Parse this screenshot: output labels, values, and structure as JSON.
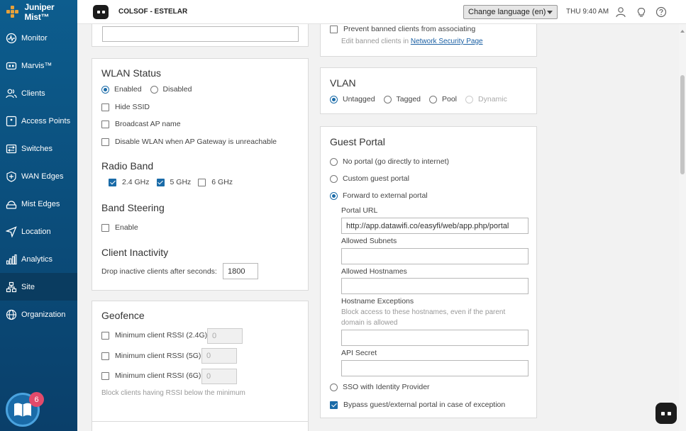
{
  "brand": {
    "name": "Juniper Mist™"
  },
  "sidebar": {
    "items": [
      {
        "label": "Monitor",
        "icon": "monitor-icon"
      },
      {
        "label": "Marvis™",
        "icon": "marvis-icon"
      },
      {
        "label": "Clients",
        "icon": "clients-icon"
      },
      {
        "label": "Access Points",
        "icon": "access-point-icon"
      },
      {
        "label": "Switches",
        "icon": "switch-icon"
      },
      {
        "label": "WAN Edges",
        "icon": "wan-edge-icon"
      },
      {
        "label": "Mist Edges",
        "icon": "mist-edge-icon"
      },
      {
        "label": "Location",
        "icon": "location-icon"
      },
      {
        "label": "Analytics",
        "icon": "analytics-icon"
      },
      {
        "label": "Site",
        "icon": "site-icon"
      },
      {
        "label": "Organization",
        "icon": "organization-icon"
      }
    ],
    "active": "Site",
    "help_badge": "6"
  },
  "topbar": {
    "org_name": "COLSOF - ESTELAR",
    "language_button": "Change language (en)",
    "clock": "THU 9:40 AM"
  },
  "banned": {
    "prevent_label": "Prevent banned clients from associating",
    "edit_prefix": "Edit banned clients in",
    "edit_link": "Network Security Page"
  },
  "wlan_status": {
    "title": "WLAN Status",
    "enabled": "Enabled",
    "disabled": "Disabled",
    "hide_ssid": "Hide SSID",
    "broadcast_ap": "Broadcast AP name",
    "disable_wlan": "Disable WLAN when AP Gateway is unreachable"
  },
  "radio_band": {
    "title": "Radio Band",
    "b24": "2.4 GHz",
    "b5": "5 GHz",
    "b6": "6 GHz"
  },
  "band_steering": {
    "title": "Band Steering",
    "enable": "Enable"
  },
  "client_inactivity": {
    "title": "Client Inactivity",
    "label": "Drop inactive clients after seconds:",
    "value": "1800"
  },
  "geofence": {
    "title": "Geofence",
    "rssi24": "Minimum client RSSI (2.4G)",
    "rssi5": "Minimum client RSSI (5G)",
    "rssi6": "Minimum client RSSI (6G)",
    "rssi_value": "0",
    "note": "Block clients having RSSI below the minimum"
  },
  "vlan": {
    "title": "VLAN",
    "untagged": "Untagged",
    "tagged": "Tagged",
    "pool": "Pool",
    "dynamic": "Dynamic"
  },
  "guest_portal": {
    "title": "Guest Portal",
    "no_portal": "No portal (go directly to internet)",
    "custom": "Custom guest portal",
    "external": "Forward to external portal",
    "portal_url_label": "Portal URL",
    "portal_url_value": "http://app.datawifi.co/easyfi/web/app.php/portal",
    "allowed_subnets": "Allowed Subnets",
    "allowed_hostnames": "Allowed Hostnames",
    "hostname_exceptions": "Hostname Exceptions",
    "hostname_exceptions_help_1": "Block access to these hostnames, even if the parent",
    "hostname_exceptions_help_2": "domain is allowed",
    "api_secret": "API Secret",
    "sso": "SSO with Identity Provider",
    "bypass": "Bypass guest/external portal in case of exception"
  }
}
